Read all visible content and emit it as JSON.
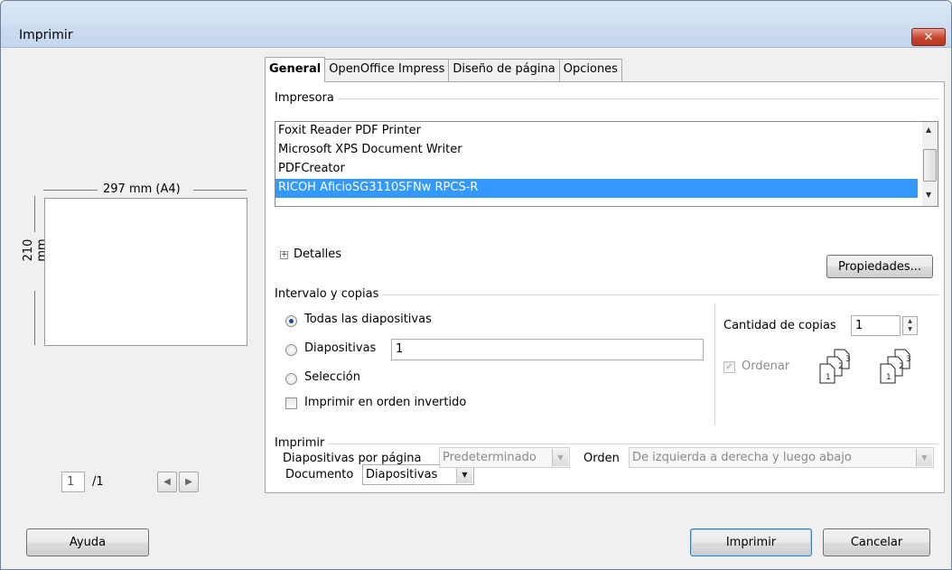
{
  "window": {
    "title": "Imprimir",
    "close_glyph": "✕"
  },
  "preview": {
    "width_label": "297 mm (A4)",
    "height_label": "210 mm",
    "page_current": "1",
    "page_total": "/1",
    "prev_icon": "◀",
    "next_icon": "▶"
  },
  "tabs": [
    "General",
    "OpenOffice Impress",
    "Diseño de página",
    "Opciones"
  ],
  "printer": {
    "group_label": "Impresora",
    "items": [
      "Foxit Reader PDF Printer",
      "Microsoft XPS Document Writer",
      "PDFCreator",
      "RICOH AficioSG3110SFNw RPCS-R"
    ],
    "selected_index": 3,
    "details_label": "Detalles",
    "expander_glyph": "+",
    "properties_label": "Propiedades..."
  },
  "range": {
    "group_label": "Intervalo y copias",
    "all_slides_label": "Todas las diapositivas",
    "slides_label": "Diapositivas",
    "slides_value": "1",
    "selection_label": "Selección",
    "reverse_label": "Imprimir en orden invertido",
    "copies_label": "Cantidad de copias",
    "copies_value": "1",
    "collate_label": "Ordenar"
  },
  "print": {
    "group_label": "Imprimir",
    "document_label": "Documento",
    "document_value": "Diapositivas",
    "slides_per_page_label": "Diapositivas por página",
    "slides_per_page_value": "Predeterminado",
    "order_label": "Orden",
    "order_value": "De izquierda a derecha y luego abajo"
  },
  "footer": {
    "help_label": "Ayuda",
    "print_label": "Imprimir",
    "cancel_label": "Cancelar"
  },
  "colors": {
    "selection": "#3399ff",
    "titlebar": "#c4d6ee",
    "close": "#c8452d"
  }
}
